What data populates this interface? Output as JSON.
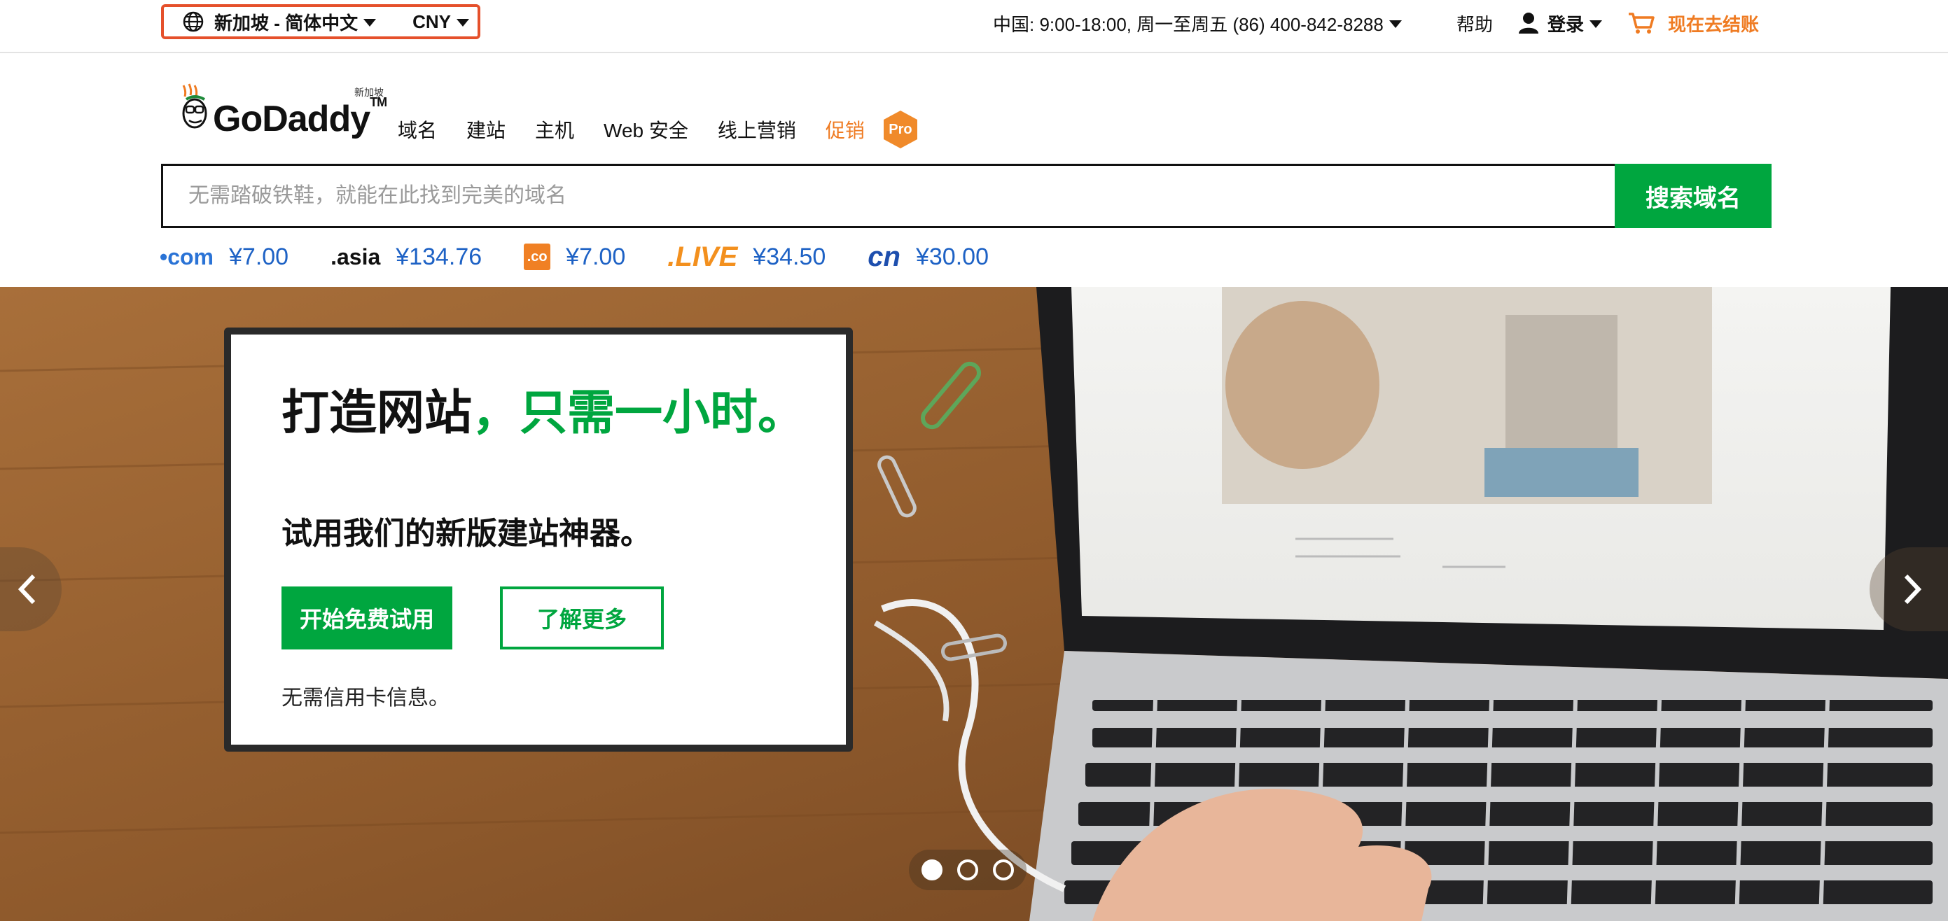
{
  "topbar": {
    "locale_label": "新加坡 - 简体中文",
    "currency_label": "CNY",
    "phone_text": "中国: 9:00-18:00, 周一至周五 (86) 400-842-8288",
    "help_label": "帮助",
    "login_label": "登录",
    "checkout_label": "现在去结账"
  },
  "header": {
    "logo_brand": "GoDaddy",
    "logo_tm": "TM",
    "logo_region": "新加坡",
    "nav": {
      "domains": "域名",
      "websites": "建站",
      "hosting": "主机",
      "security": "Web 安全",
      "marketing": "线上营销",
      "promotions": "促销",
      "pro_badge": "Pro"
    }
  },
  "search": {
    "placeholder": "无需踏破铁鞋，就能在此找到完美的域名",
    "button_label": "搜索域名"
  },
  "tlds": [
    {
      "logo": "•com",
      "price": "¥7.00"
    },
    {
      "logo": ".asia",
      "price": "¥134.76"
    },
    {
      "logo": ".co",
      "price": "¥7.00"
    },
    {
      "logo": ".LIVE",
      "price": "¥34.50"
    },
    {
      "logo": "cn",
      "price": "¥30.00"
    }
  ],
  "hero": {
    "title_black": "打造网站",
    "title_green": "，只需一小时。",
    "subtitle": "试用我们的新版建站神器。",
    "primary_button": "开始免费试用",
    "secondary_button": "了解更多",
    "note": "无需信用卡信息。",
    "slide_count": 3,
    "active_slide": 1
  },
  "colors": {
    "brand_green": "#00a63f",
    "accent_orange": "#ef7b22",
    "price_blue": "#1e62c5",
    "highlight_border": "#e5502b"
  },
  "icons": [
    "globe-icon",
    "caret-down-icon",
    "user-icon",
    "cart-icon",
    "chevron-left-icon",
    "chevron-right-icon",
    "godaddy-mascot-icon"
  ]
}
